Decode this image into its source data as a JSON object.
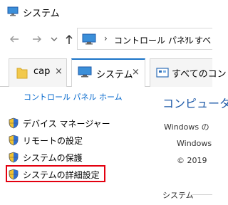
{
  "window": {
    "title": "システム"
  },
  "address": {
    "crumb1": "コントロール パネル",
    "crumb2": "すべ"
  },
  "tabs": [
    {
      "label": "cap",
      "close": "×"
    },
    {
      "label": "システム",
      "close": "×"
    },
    {
      "label": "すべてのコン"
    }
  ],
  "sidebar": {
    "home_link": "コントロール パネル ホーム",
    "items": [
      {
        "label": "デバイス マネージャー"
      },
      {
        "label": "リモートの設定"
      },
      {
        "label": "システムの保護"
      },
      {
        "label": "システムの詳細設定"
      }
    ]
  },
  "main": {
    "heading": "コンピュータ",
    "line1": "Windows の",
    "line2": "Windows",
    "line3": "© 2019",
    "section": "システム"
  },
  "colors": {
    "accent": "#1a73c8",
    "link": "#0066cc",
    "highlight": "#e3000f"
  }
}
